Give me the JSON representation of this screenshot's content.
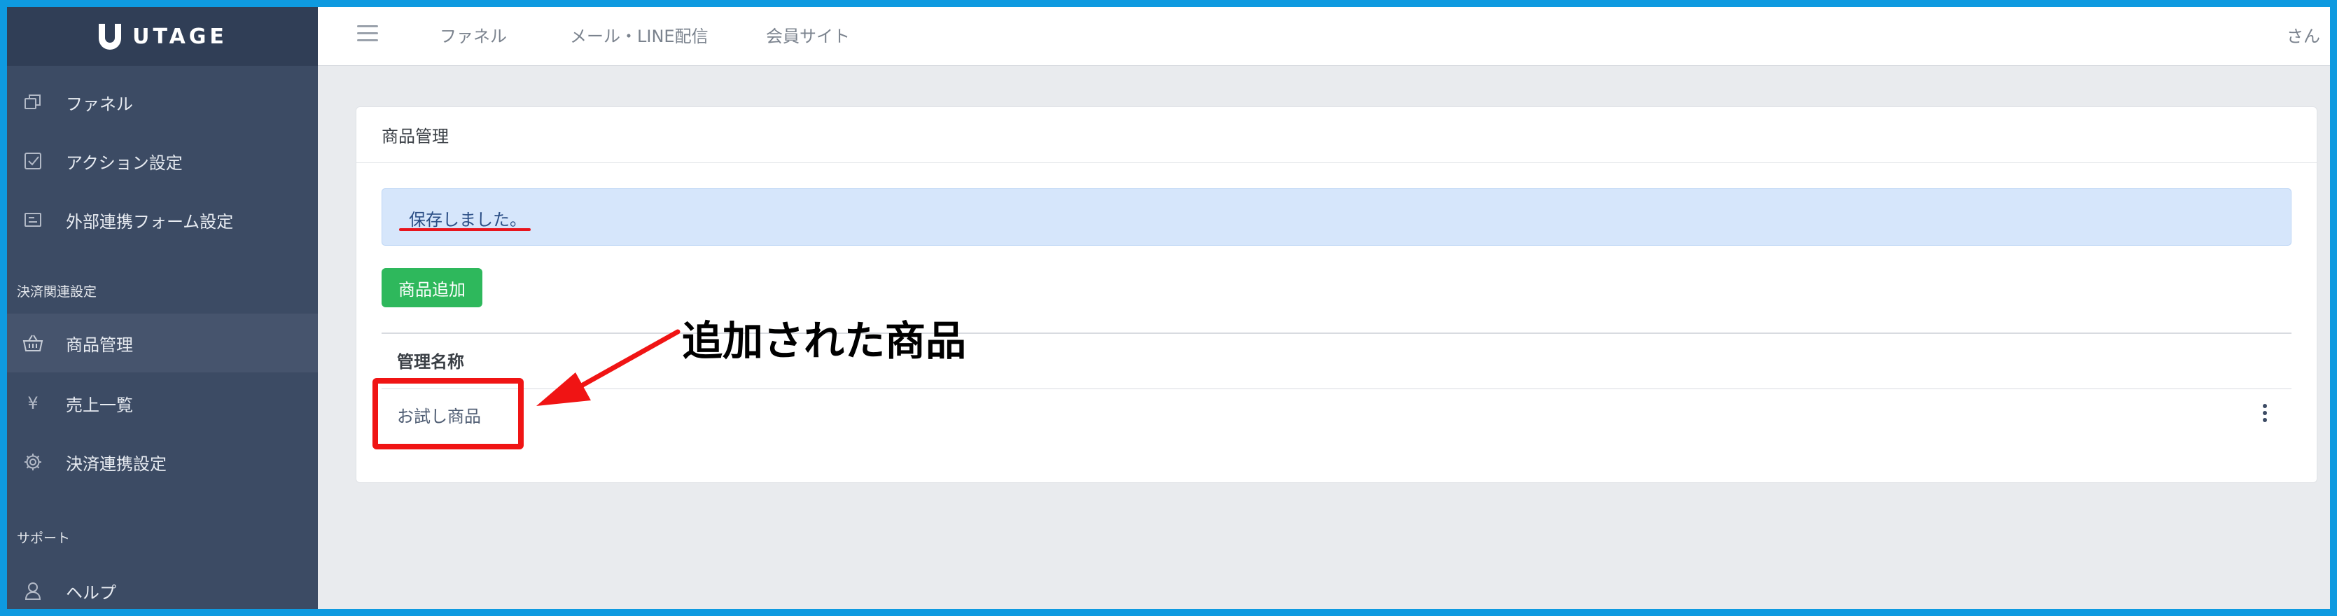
{
  "brand": {
    "logo_text": "UTAGE"
  },
  "header": {
    "links": [
      "ファネル",
      "メール・LINE配信",
      "会員サイト"
    ],
    "user": "さん"
  },
  "sidebar": {
    "items_top": [
      {
        "label": "ファネル",
        "icon": "copy-icon"
      },
      {
        "label": "アクション設定",
        "icon": "checkbox-icon"
      },
      {
        "label": "外部連携フォーム設定",
        "icon": "form-icon"
      }
    ],
    "section_payment": "決済関連設定",
    "items_payment": [
      {
        "label": "商品管理",
        "icon": "basket-icon",
        "active": true
      },
      {
        "label": "売上一覧",
        "icon": "yen-icon"
      },
      {
        "label": "決済連携設定",
        "icon": "gear-icon"
      }
    ],
    "section_support": "サポート",
    "items_support": [
      {
        "label": "ヘルプ",
        "icon": "user-icon"
      }
    ]
  },
  "card": {
    "title": "商品管理",
    "alert": "保存しました。",
    "add_button": "商品追加",
    "column_header": "管理名称",
    "rows": [
      {
        "name": "お試し商品"
      }
    ]
  },
  "annotation": {
    "text": "追加された商品"
  },
  "colors": {
    "sidebar": "#3c4b64",
    "accent_green": "#2eb85c",
    "alert_bg": "#d6e6fb",
    "highlight_red": "#f01414",
    "frame_blue": "#0e9ae0"
  }
}
